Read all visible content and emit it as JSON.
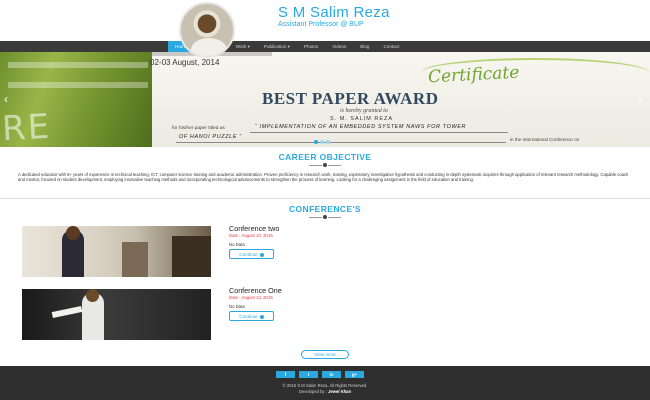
{
  "header": {
    "name": "S M Salim Reza",
    "subtitle": "Assistant Professor @ BUP"
  },
  "nav": {
    "items": [
      {
        "label": "Home",
        "active": true
      },
      {
        "label": "Portfolio ▾"
      },
      {
        "label": "Work ▾"
      },
      {
        "label": "Publication ▾"
      },
      {
        "label": "Photos"
      },
      {
        "label": "Videos"
      },
      {
        "label": "Blog"
      },
      {
        "label": "Contact"
      }
    ]
  },
  "slider": {
    "date": "02-03 August, 2014",
    "certificate_script": "Certificate",
    "award_title": "BEST PAPER AWARD",
    "granted": "is hereby granted to",
    "recipient": "S. M. SALIM REZA",
    "paper_prefix": "for his/her paper titled as",
    "handwritten_1": "“ IMPLEMENTATION OF AN EMBEDDED SYSTEM NAWS FOR TOWER",
    "handwritten_2": "OF HANOI PUZZLE ”",
    "conference_suffix": "in the International Conference on",
    "left_arrow": "‹",
    "right_arrow": "›"
  },
  "career": {
    "title": "CAREER OBJECTIVE",
    "text": "A dedicated educator with 8+ years of experience in technical teaching, ICT, computer science training and academic administration. Proven proficiency in research work, training, exploratory investigative hypothesis and conducting in-depth systematic inquiries through application of relevant research methodology. Capable coach and mentor, focused on student development, employing innovative teaching methods and incorporating technological advancements to strengthen the process of learning. Looking for a challenging assignment in the field of education and training."
  },
  "conferences": {
    "title": "CONFERENCE'S",
    "items": [
      {
        "title": "Conference two",
        "date": "Date : August 13, 2015",
        "desc": "No Data",
        "button": "Continue"
      },
      {
        "title": "Conference One",
        "date": "Date : August 13, 2015",
        "desc": "No Data",
        "button": "Continue"
      }
    ],
    "view_more": "View more"
  },
  "footer": {
    "social": [
      "f",
      "t",
      "in",
      "g+"
    ],
    "copyright": "© 2015 S M Salim Reza. All Rights Reserved.",
    "developed_prefix": "Developed by :",
    "developer": "Jewel Khan"
  },
  "colors": {
    "accent": "#29a9e0",
    "nav_bg": "#3a3a3a",
    "footer_bg": "#2f2f2f",
    "date_red": "#e23c3c"
  }
}
